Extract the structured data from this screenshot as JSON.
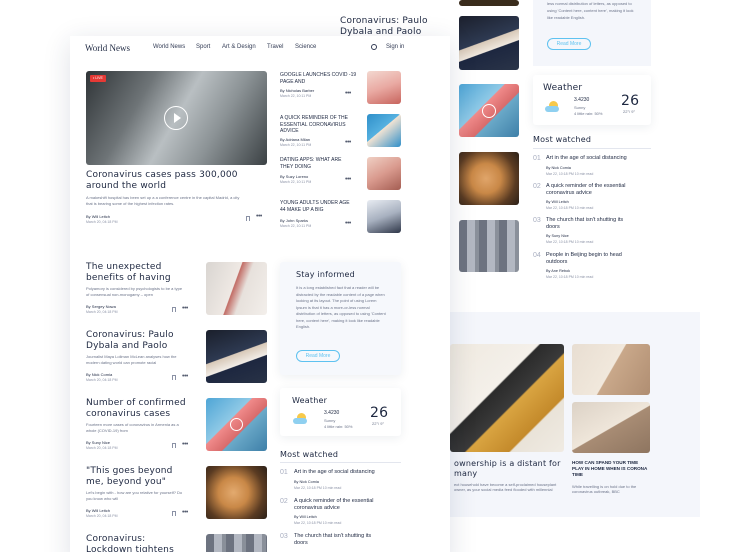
{
  "nav": {
    "logo": "World News",
    "links": [
      "World",
      "World News",
      "Sport",
      "Art & Design",
      "Travel",
      "Science"
    ],
    "signin": "Sign in"
  },
  "hero": {
    "badge": "• LIVE",
    "title": "Coronavirus cases pass 300,000 around the world",
    "excerpt": "A makeshift hospital has been set up a a conference centre in the capital Madrid, a city that is bearing some of the highest infection rates.",
    "by": "By Will Leitch",
    "date": "March 20, 04:18 PM"
  },
  "side_list": [
    {
      "title": "GOOGLE LAUNCHES COVID -19 PAGE AND",
      "by": "By Nicholas Barber",
      "date": "March 22, 10:11 PM"
    },
    {
      "title": "A QUICK REMINDER OF THE ESSENTIAL CORONAVIRUS ADVICE",
      "by": "By Adriana Milan",
      "date": "March 22, 10:11 PM"
    },
    {
      "title": "DATING APPS: WHAT ARE THEY DOING",
      "by": "By Suzy Loreno",
      "date": "March 22, 10:11 PM"
    },
    {
      "title": "YOUNG ADULTS UNDER AGE 44 MAKE UP A BIG",
      "by": "By John Sparks",
      "date": "March 22, 10:11 PM"
    }
  ],
  "articles": [
    {
      "title": "The unexpected benefits of having",
      "excerpt": "Polyamory is considered by psychologists to be a type of consensual non-monogamy – open",
      "by": "By Sergey Nowa",
      "date": "March 20, 04:18 PM"
    },
    {
      "title": "Coronavirus: Paulo Dybala and Paolo",
      "excerpt": "Journalist Maya Lollman McLean analyses how the modern dating world can promote racial",
      "by": "By Nick Comia",
      "date": "March 20, 04:18 PM"
    },
    {
      "title": "Number of confirmed coronavirus cases",
      "excerpt": "Fourteen more cases of coronavirus in Armenia as a whole (COVID-19) from",
      "by": "By Suny Nice",
      "date": "March 20, 04:18 PM"
    },
    {
      "title": "\"This goes beyond me, beyond you\"",
      "excerpt": "Let's begin with - how are you relative for yourself? Do you know who will",
      "by": "By Will Leitch",
      "date": "March 20, 04:18 PM"
    },
    {
      "title": "Coronavirus: Lockdown tightens",
      "excerpt": "",
      "by": "",
      "date": ""
    }
  ],
  "stay_informed": {
    "title": "Stay informed",
    "body": "It is a long established fact that a reader will be distracted by the readable content of a page when looking at its layout. The point of using Lorem Ipsum is that it has a more-or-less normal distribution of letters, as opposed to using 'Content here, content here', making it look like readable English.",
    "button": "Read More"
  },
  "weather": {
    "title": "Weather",
    "value": "3.4230",
    "condition": "Sunny",
    "rain": "4 little rain: 50%",
    "temp": "26",
    "deg": "°",
    "range": "22°/ 9°"
  },
  "most_watched": {
    "title": "Most watched",
    "items": [
      {
        "num": "01",
        "title": "Art in the age of social distancing",
        "by": "By Nick Comia",
        "date": "Mar 22, 10:18 PM  10 min read"
      },
      {
        "num": "02",
        "title": "A quick reminder of the essential coronavirus advice",
        "by": "By Will Leitch",
        "date": "Mar 22, 10:18 PM  10 min read"
      },
      {
        "num": "03",
        "title": "The church that isn't shutting its doors",
        "by": "By Suny Nice",
        "date": "Mar 22, 10:18 PM  10 min read"
      },
      {
        "num": "04",
        "title": "People in Beijing begin to head outdoors",
        "by": "By Ane Rebok",
        "date": "Mar 22, 10:18 PM  10 min read"
      }
    ]
  },
  "bg_top": {
    "title": "Coronavirus: Paulo Dybala and Paolo",
    "text1": "less normal distribution of letters, as opposed to using 'Content here, content here', making it look like readable English.",
    "button": "Read More"
  },
  "bg_bottom": {
    "caption1": "ownership is a distant for many",
    "excerpt1": "ect household have become a self-proclaimed houseplant owner, as your social media feed flooded with millennial",
    "caption2": "HOW CAN SPAND YOUR TIME PLAY IN HOME WHEN IS CORONA TIME",
    "excerpt2": "While travelling is on hold due to the coronavirus outbreak, BBC"
  }
}
